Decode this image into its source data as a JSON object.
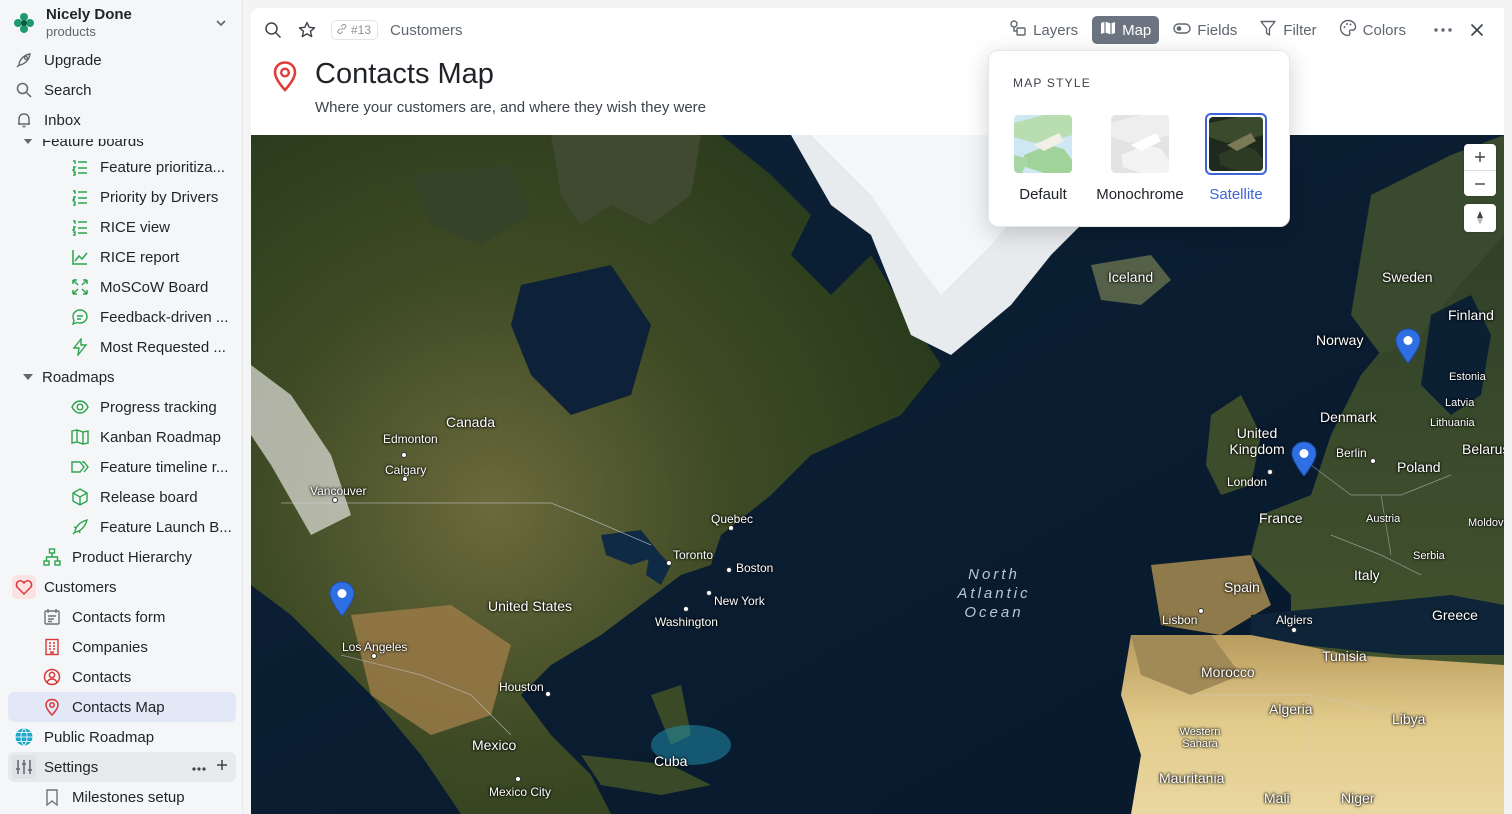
{
  "workspace": {
    "name": "Nicely Done",
    "subtitle": "products"
  },
  "nav": {
    "upgrade": "Upgrade",
    "search": "Search",
    "inbox": "Inbox"
  },
  "tree": {
    "feature_boards": "Feature boards",
    "fb_items": [
      "Feature prioritiza...",
      "Priority by Drivers",
      "RICE view",
      "RICE report",
      "MoSCoW Board",
      "Feedback-driven ...",
      "Most Requested ..."
    ],
    "roadmaps": "Roadmaps",
    "rm_items": [
      "Progress tracking",
      "Kanban Roadmap",
      "Feature timeline r...",
      "Release board",
      "Feature Launch B..."
    ],
    "product_hierarchy": "Product Hierarchy",
    "customers": "Customers",
    "cu_items": [
      "Contacts form",
      "Companies",
      "Contacts",
      "Contacts Map"
    ],
    "public_roadmap": "Public Roadmap",
    "settings": "Settings",
    "milestones": "Milestones setup"
  },
  "toolbar": {
    "record_id": "#13",
    "breadcrumb": "Customers",
    "layers": "Layers",
    "map": "Map",
    "fields": "Fields",
    "filter": "Filter",
    "colors": "Colors"
  },
  "page": {
    "title": "Contacts Map",
    "subtitle": "Where your customers are, and where they wish they were"
  },
  "map_style": {
    "heading": "MAP STYLE",
    "options": [
      "Default",
      "Monochrome",
      "Satellite"
    ],
    "selected": "Satellite"
  },
  "map_labels": {
    "countries": [
      "Canada",
      "United States",
      "Mexico",
      "Cuba",
      "Iceland",
      "Sweden",
      "Finland",
      "Norway",
      "Denmark",
      "United Kingdom",
      "Poland",
      "France",
      "Spain",
      "Italy",
      "Greece",
      "Morocco",
      "Algeria",
      "Tunisia",
      "Libya",
      "Western Sahara",
      "Mauritania",
      "Mali",
      "Niger",
      "Estonia",
      "Latvia",
      "Lithuania",
      "Belarus",
      "Serbia",
      "Austria",
      "Moldova"
    ],
    "cities": [
      "Edmonton",
      "Calgary",
      "Vancouver",
      "Quebec",
      "Toronto",
      "Boston",
      "New York",
      "Washington",
      "Los Angeles",
      "Houston",
      "Mexico City",
      "London",
      "Berlin",
      "Lisbon",
      "Algiers"
    ],
    "ocean": "North Atlantic Ocean"
  },
  "colors": {
    "accent": "#3d63d6",
    "pin": "#2f6fe4",
    "title_icon": "#e03a3a",
    "active_view_bg": "#6b7480"
  }
}
